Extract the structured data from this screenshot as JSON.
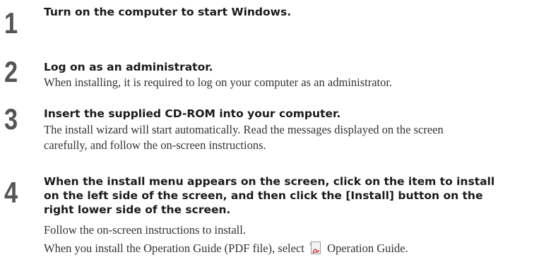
{
  "steps": [
    {
      "number": "1",
      "heading": [
        "Turn on the computer to start Windows."
      ],
      "body": []
    },
    {
      "number": "2",
      "heading": [
        "Log on as an administrator."
      ],
      "body": [
        "When installing, it is required to log on your computer as an administrator."
      ]
    },
    {
      "number": "3",
      "heading": [
        "Insert the supplied CD-ROM into your computer."
      ],
      "body": [
        "The install wizard will start automatically. Read the messages displayed on the screen",
        "carefully, and follow the on-screen instructions."
      ]
    },
    {
      "number": "4",
      "heading": [
        "When the install menu appears on the screen, click on the item to install",
        "on the left side of the screen, and then click the [Install] button on the",
        "right lower side of the screen."
      ],
      "body": [
        "Follow the on-screen instructions to install."
      ],
      "body_last_prefix": "When you install the Operation Guide (PDF file), select",
      "body_last_suffix": "Operation Guide.",
      "body_last_icon": "pdf-file-icon"
    }
  ]
}
